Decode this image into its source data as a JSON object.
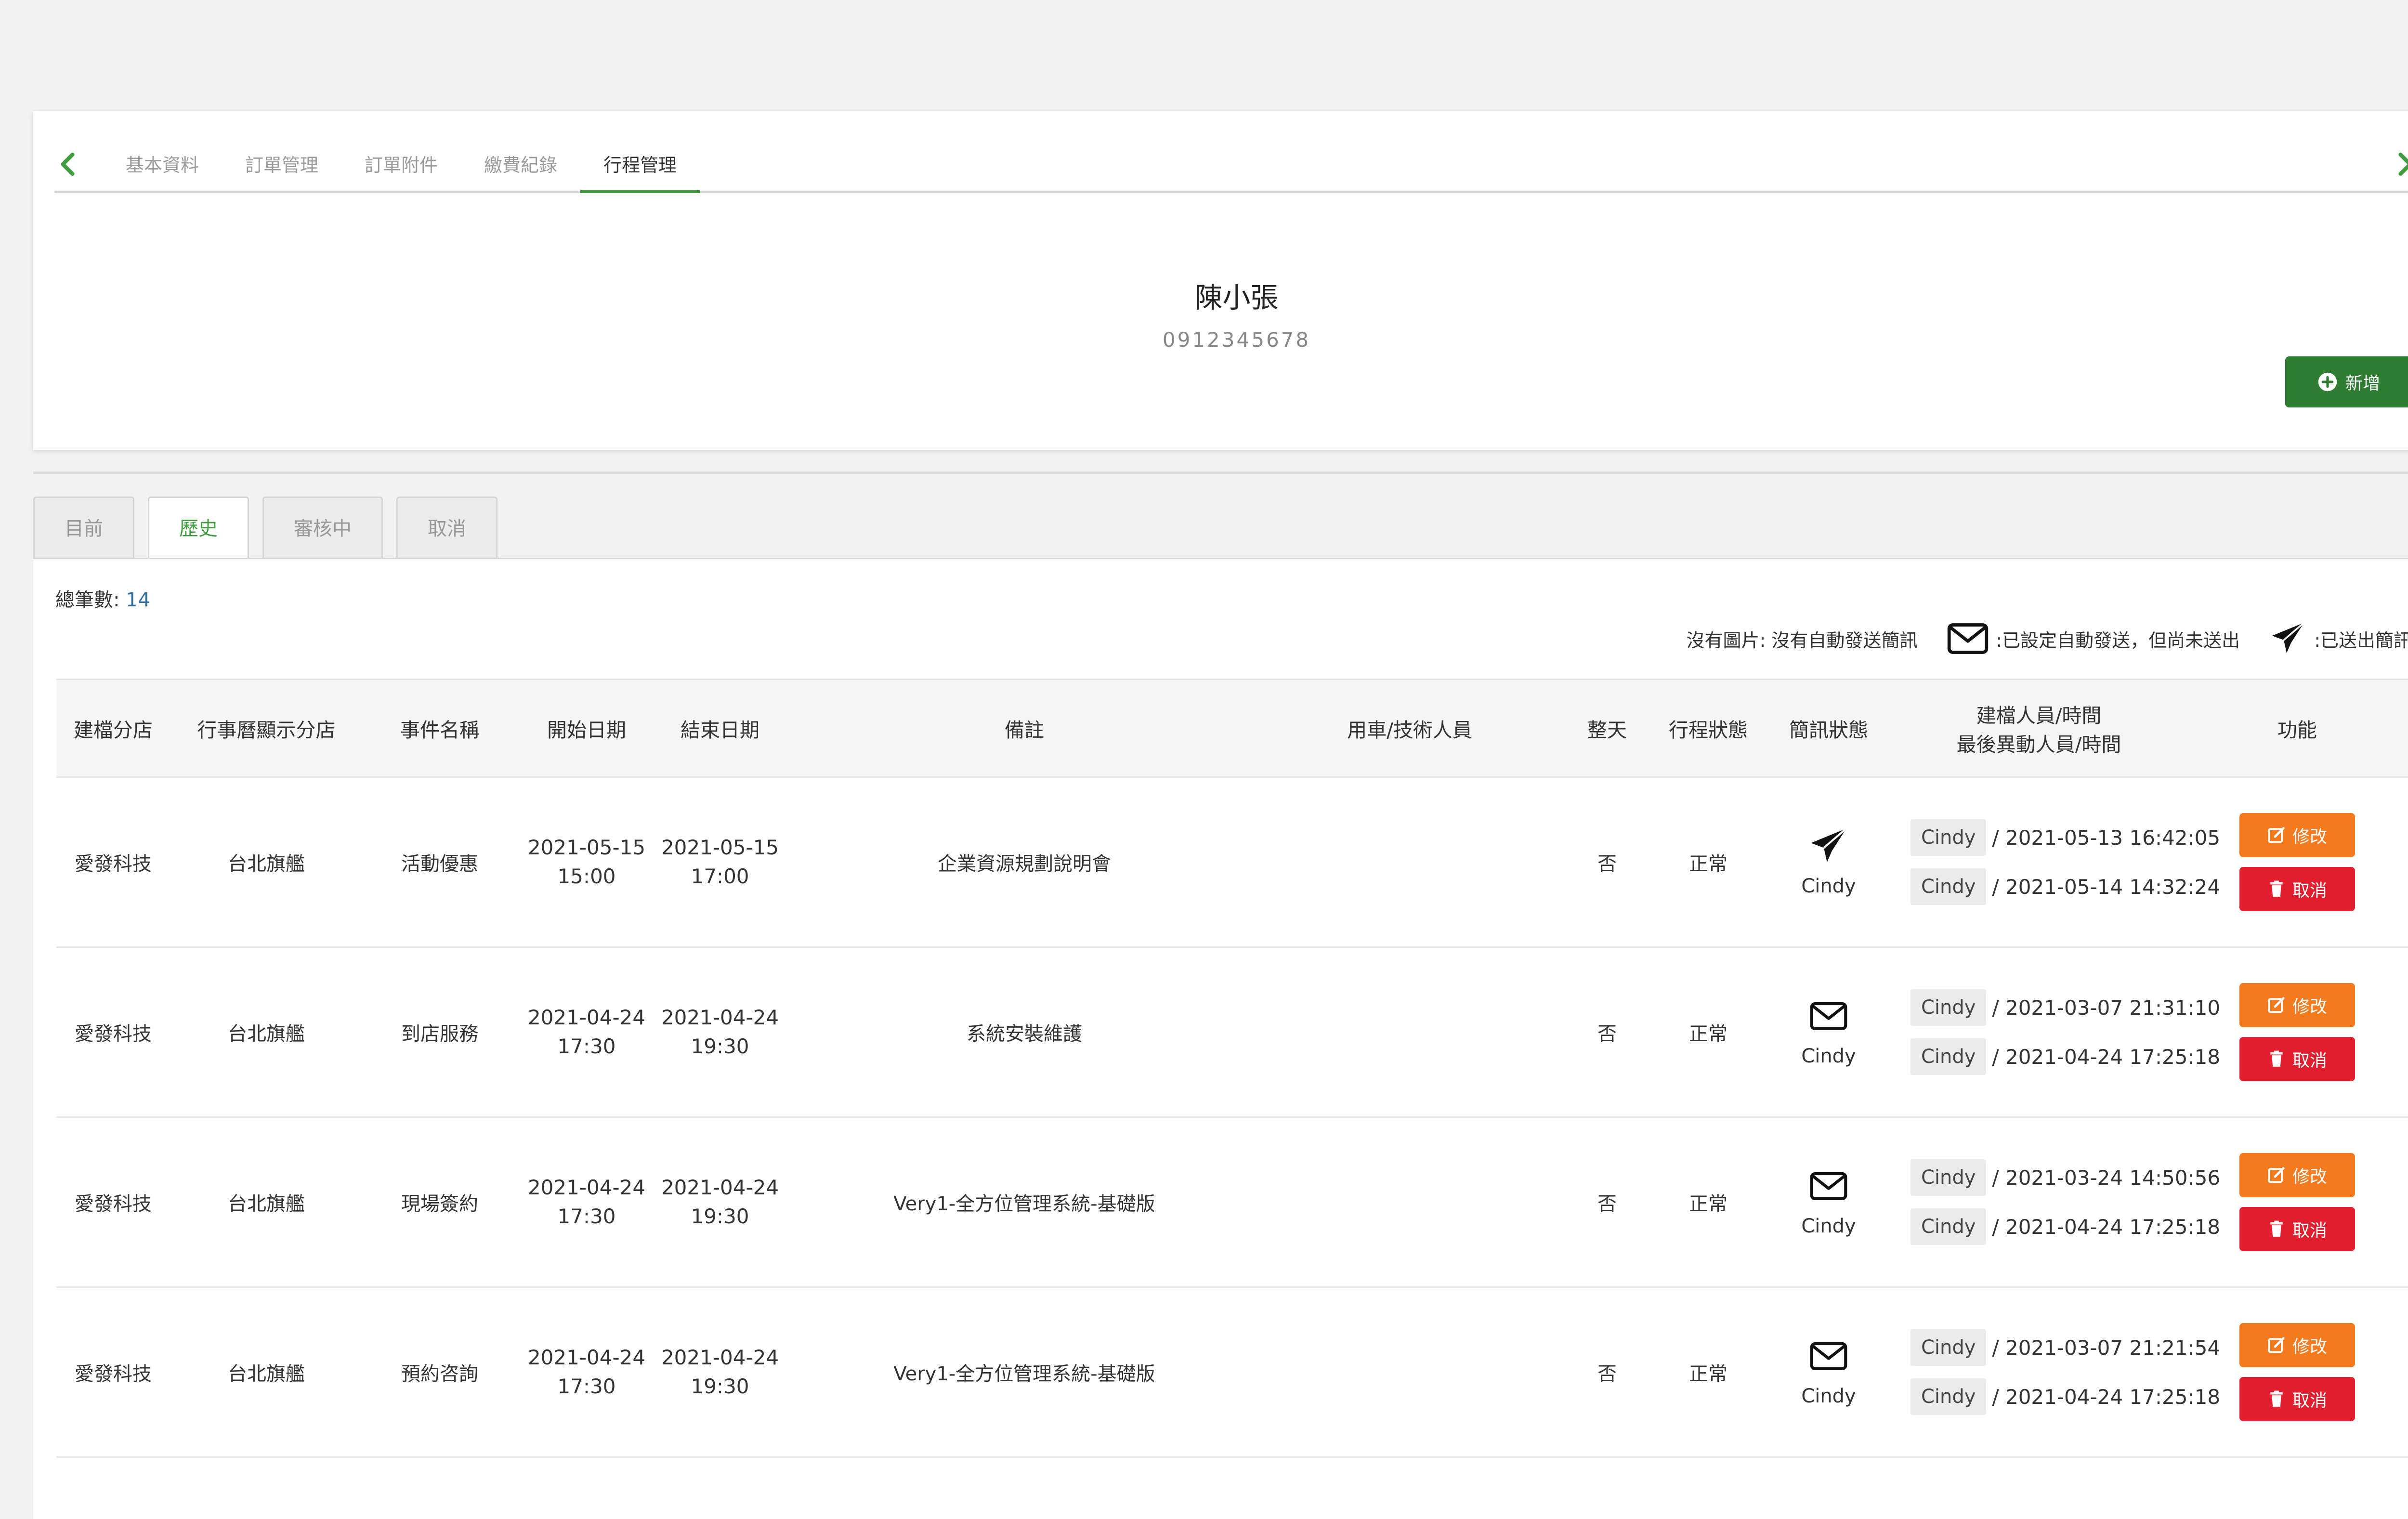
{
  "subnav": {
    "tabs": [
      {
        "label": "基本資料"
      },
      {
        "label": "訂單管理"
      },
      {
        "label": "訂單附件"
      },
      {
        "label": "繳費紀錄"
      },
      {
        "label": "行程管理"
      }
    ],
    "active": "行程管理"
  },
  "customer": {
    "name": "陳小張",
    "phone": "0912345678"
  },
  "add_button": {
    "label": "新增",
    "icon": "plus-circle-icon"
  },
  "status_tabs": [
    {
      "label": "目前"
    },
    {
      "label": "歷史"
    },
    {
      "label": "審核中"
    },
    {
      "label": "取消"
    }
  ],
  "status_active": "歷史",
  "summary": {
    "total_label": "總筆數:",
    "total": "14"
  },
  "legend": {
    "no_image": "沒有圖片: 沒有自動發送簡訊",
    "envelope": ":已設定自動發送，但尚未送出",
    "sent": ":已送出簡訊"
  },
  "table": {
    "headers": {
      "branch": "建檔分店",
      "display_branch": "行事曆顯示分店",
      "event": "事件名稱",
      "start": "開始日期",
      "end": "結束日期",
      "note": "備註",
      "staff": "用車/技術人員",
      "all_day": "整天",
      "status": "行程狀態",
      "sms": "簡訊狀態",
      "audit_line1": "建檔人員/時間",
      "audit_line2": "最後異動人員/時間",
      "actions": "功能"
    },
    "rows": [
      {
        "branch": "愛發科技",
        "display_branch": "台北旗艦",
        "event": "活動優惠",
        "start_date": "2021-05-15",
        "start_time": "15:00",
        "end_date": "2021-05-15",
        "end_time": "17:00",
        "note": "企業資源規劃說明會",
        "staff": "",
        "all_day": "否",
        "status": "正常",
        "sms_icon": "paper-plane-icon",
        "sms_user": "Cindy",
        "created_by": "Cindy",
        "created_at": "/ 2021-05-13 16:42:05",
        "modified_by": "Cindy",
        "modified_at": "/ 2021-05-14 14:32:24",
        "edit_label": "修改",
        "cancel_label": "取消"
      },
      {
        "branch": "愛發科技",
        "display_branch": "台北旗艦",
        "event": "到店服務",
        "start_date": "2021-04-24",
        "start_time": "17:30",
        "end_date": "2021-04-24",
        "end_time": "19:30",
        "note": "系統安裝維護",
        "staff": "",
        "all_day": "否",
        "status": "正常",
        "sms_icon": "envelope-icon",
        "sms_user": "Cindy",
        "created_by": "Cindy",
        "created_at": "/ 2021-03-07 21:31:10",
        "modified_by": "Cindy",
        "modified_at": "/ 2021-04-24 17:25:18",
        "edit_label": "修改",
        "cancel_label": "取消"
      },
      {
        "branch": "愛發科技",
        "display_branch": "台北旗艦",
        "event": "現場簽約",
        "start_date": "2021-04-24",
        "start_time": "17:30",
        "end_date": "2021-04-24",
        "end_time": "19:30",
        "note": "Very1-全方位管理系統-基礎版",
        "staff": "",
        "all_day": "否",
        "status": "正常",
        "sms_icon": "envelope-icon",
        "sms_user": "Cindy",
        "created_by": "Cindy",
        "created_at": "/ 2021-03-24 14:50:56",
        "modified_by": "Cindy",
        "modified_at": "/ 2021-04-24 17:25:18",
        "edit_label": "修改",
        "cancel_label": "取消"
      },
      {
        "branch": "愛發科技",
        "display_branch": "台北旗艦",
        "event": "預約咨詢",
        "start_date": "2021-04-24",
        "start_time": "17:30",
        "end_date": "2021-04-24",
        "end_time": "19:30",
        "note": "Very1-全方位管理系統-基礎版",
        "staff": "",
        "all_day": "否",
        "status": "正常",
        "sms_icon": "envelope-icon",
        "sms_user": "Cindy",
        "created_by": "Cindy",
        "created_at": "/ 2021-03-07 21:21:54",
        "modified_by": "Cindy",
        "modified_at": "/ 2021-04-24 17:25:18",
        "edit_label": "修改",
        "cancel_label": "取消"
      }
    ]
  },
  "colors": {
    "accent_green": "#3f9d3f",
    "add_button": "#2f7d32",
    "edit_button": "#f47a1f",
    "cancel_button": "#e01e2d",
    "count_number": "#2e6d9c"
  }
}
